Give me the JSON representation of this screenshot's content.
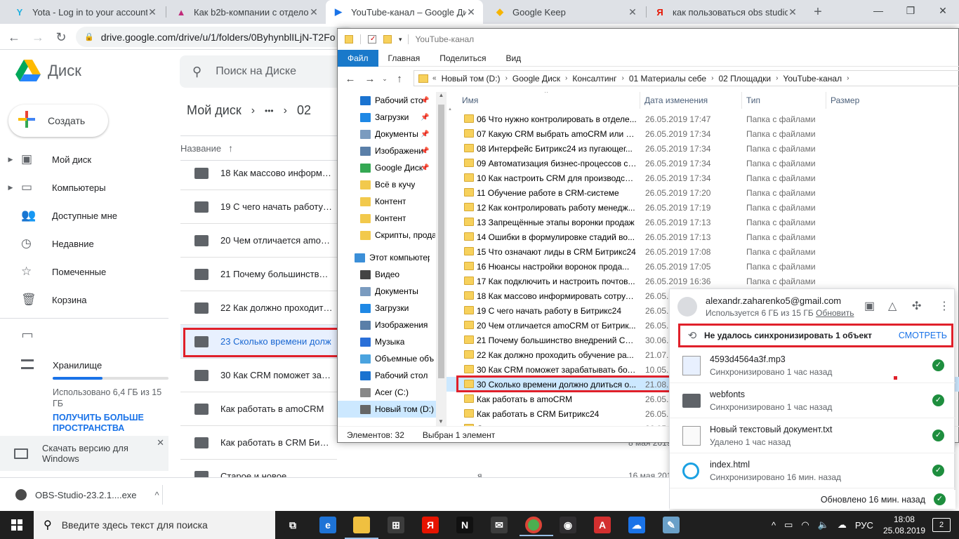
{
  "chrome": {
    "tabs": [
      {
        "title": "Yota - Log in to your account",
        "icon": "yota-icon",
        "color": "#20b0e0"
      },
      {
        "title": "Как b2b-компании с отделом",
        "icon": "triangle-logo-icon",
        "color": "#c12a7a"
      },
      {
        "title": "YouTube-канал – Google Диск",
        "icon": "google-drive-icon",
        "color": "#1a73e8"
      },
      {
        "title": "Google Keep",
        "icon": "google-keep-icon",
        "color": "#f6b400"
      },
      {
        "title": "как пользоваться obs studio",
        "icon": "yandex-icon",
        "color": "#e61400"
      }
    ],
    "active_tab": 2,
    "url": "drive.google.com/drive/u/1/folders/0ByhynblILjN-T2Fo"
  },
  "drive": {
    "app_name": "Диск",
    "search_placeholder": "Поиск на Диске",
    "create_label": "Создать",
    "nav": [
      {
        "label": "Мой диск",
        "icon": "my-drive-icon",
        "expand": true
      },
      {
        "label": "Компьютеры",
        "icon": "computers-icon",
        "expand": true
      },
      {
        "label": "Доступные мне",
        "icon": "shared-with-me-icon",
        "expand": false
      },
      {
        "label": "Недавние",
        "icon": "clock-icon",
        "expand": false
      },
      {
        "label": "Помеченные",
        "icon": "star-icon",
        "expand": false
      },
      {
        "label": "Корзина",
        "icon": "trash-icon",
        "expand": false
      }
    ],
    "storage_label": "Хранилище",
    "storage_used_text": "Использовано 6,4 ГБ из 15 ГБ",
    "storage_fraction": 0.43,
    "storage_more": "ПОЛУЧИТЬ БОЛЬШЕ ПРОСТРАНСТВА",
    "download_promo": "Скачать версию для Windows",
    "breadcrumb": {
      "root": "Мой диск",
      "ellipsis": "•••",
      "next": "02"
    },
    "name_column": "Название",
    "rows": [
      "18 Как массово информиро",
      "19 С чего начать работу в Б",
      "20 Чем отличается amoCRM",
      "21 Почему большинство вне",
      "22 Как должно проходить о",
      "23 Сколько времени долж",
      "30 Как CRM поможет зараб",
      "Как работать в amoCRM",
      "Как работать в CRM Битрикс24",
      "Старое и новое"
    ],
    "selected_row": 5,
    "right_dates": [
      "8 мая 2019 г.",
      "16 мая 2019 г."
    ],
    "right_owner": "я"
  },
  "explorer": {
    "title": "YouTube-канал",
    "ribbon": [
      "Файл",
      "Главная",
      "Поделиться",
      "Вид"
    ],
    "path": [
      "Новый том (D:)",
      "Google Диск",
      "Консалтинг",
      "01 Материалы себе",
      "02 Площадки",
      "YouTube-канал"
    ],
    "nav": [
      {
        "label": "Рабочий сто",
        "pin": true,
        "color": "#1a73d0"
      },
      {
        "label": "Загрузки",
        "pin": true,
        "color": "#1e88e5"
      },
      {
        "label": "Документы",
        "pin": true,
        "color": "#7a9bbf"
      },
      {
        "label": "Изображени",
        "pin": true,
        "color": "#5a7fa8"
      },
      {
        "label": "Google Диск",
        "pin": true,
        "color": "#34a853"
      },
      {
        "label": "Всё в кучу",
        "pin": false,
        "color": "#f2c94c"
      },
      {
        "label": "Контент",
        "pin": false,
        "color": "#f2c94c"
      },
      {
        "label": "Контент",
        "pin": false,
        "color": "#f2c94c"
      },
      {
        "label": "Скрипты, прода",
        "pin": false,
        "color": "#f2c94c"
      },
      {
        "label": "Этот компьютер",
        "pin": false,
        "color": "#3b8fd8"
      },
      {
        "label": "Видео",
        "pin": false,
        "color": "#444"
      },
      {
        "label": "Документы",
        "pin": false,
        "color": "#7a9bbf"
      },
      {
        "label": "Загрузки",
        "pin": false,
        "color": "#1e88e5"
      },
      {
        "label": "Изображения",
        "pin": false,
        "color": "#5a7fa8"
      },
      {
        "label": "Музыка",
        "pin": false,
        "color": "#2a6fd8"
      },
      {
        "label": "Объемные объ",
        "pin": false,
        "color": "#4aa3df"
      },
      {
        "label": "Рабочий стол",
        "pin": false,
        "color": "#1a73d0"
      },
      {
        "label": "Acer (C:)",
        "pin": false,
        "color": "#888"
      },
      {
        "label": "Новый том (D:)",
        "pin": false,
        "color": "#666"
      }
    ],
    "selected_nav": 18,
    "columns": {
      "name": "Имя",
      "date": "Дата изменения",
      "type": "Тип",
      "size": "Размер"
    },
    "files": [
      {
        "name": "06 Что нужно контролировать в отделе...",
        "date": "26.05.2019 17:47",
        "type": "Папка с файлами"
      },
      {
        "name": "07 Какую CRM выбрать amoCRM или Б...",
        "date": "26.05.2019 17:34",
        "type": "Папка с файлами"
      },
      {
        "name": "08 Интерфейс Битрикс24 из пугающег...",
        "date": "26.05.2019 17:34",
        "type": "Папка с файлами"
      },
      {
        "name": "09 Автоматизация бизнес-процессов с ...",
        "date": "26.05.2019 17:34",
        "type": "Папка с файлами"
      },
      {
        "name": "10 Как настроить CRM для производств...",
        "date": "26.05.2019 17:34",
        "type": "Папка с файлами"
      },
      {
        "name": "11 Обучение работе в CRM-системе",
        "date": "26.05.2019 17:20",
        "type": "Папка с файлами"
      },
      {
        "name": "12 Как контролировать работу менедж...",
        "date": "26.05.2019 17:19",
        "type": "Папка с файлами"
      },
      {
        "name": "13 Запрещённые этапы воронки продаж",
        "date": "26.05.2019 17:13",
        "type": "Папка с файлами"
      },
      {
        "name": "14 Ошибки в формулировке стадий во...",
        "date": "26.05.2019 17:13",
        "type": "Папка с файлами"
      },
      {
        "name": "15 Что означают лиды в CRM Битрикс24",
        "date": "26.05.2019 17:08",
        "type": "Папка с файлами"
      },
      {
        "name": "16 Нюансы настройки воронок прода...",
        "date": "26.05.2019 17:05",
        "type": "Папка с файлами"
      },
      {
        "name": "17 Как подключить и настроить почтов...",
        "date": "26.05.2019 16:36",
        "type": "Папка с файлами"
      },
      {
        "name": "18 Как массово информировать сотруд...",
        "date": "26.05.2",
        "type": ""
      },
      {
        "name": "19 С чего начать работу в Битрикс24",
        "date": "26.05.2",
        "type": ""
      },
      {
        "name": "20 Чем отличается amoCRM от Битрик...",
        "date": "26.05.2",
        "type": ""
      },
      {
        "name": "21 Почему большинство внедрений CR...",
        "date": "30.06.2",
        "type": ""
      },
      {
        "name": "22 Как должно проходить обучение ра...",
        "date": "21.07.2",
        "type": ""
      },
      {
        "name": "30 Как CRM поможет зарабатывать бол...",
        "date": "10.05.2",
        "type": ""
      },
      {
        "name": "30 Сколько времени должно длиться о...",
        "date": "21.08.2",
        "type": ""
      },
      {
        "name": "Как работать в amoCRM",
        "date": "26.05.2",
        "type": ""
      },
      {
        "name": "Как работать в CRM Битрикс24",
        "date": "26.05.2",
        "type": ""
      },
      {
        "name": "С...",
        "date": "26.05.2",
        "type": ""
      }
    ],
    "selected_file": 18,
    "status_count": "Элементов: 32",
    "status_selected": "Выбран 1 элемент"
  },
  "sync": {
    "email": "alexandr.zaharenko5@gmail.com",
    "usage": "Используется 6 ГБ из 15 ГБ",
    "upgrade": "Обновить",
    "error": "Не удалось синхронизировать 1 объект",
    "error_action": "СМОТРЕТЬ",
    "items": [
      {
        "name": "4593d4564a3f.mp3",
        "status": "Синхронизировано 1 час назад",
        "icon": "mp3-file-icon"
      },
      {
        "name": "webfonts",
        "status": "Синхронизировано 1 час назад",
        "icon": "folder-icon"
      },
      {
        "name": "Новый текстовый документ.txt",
        "status": "Удалено 1 час назад",
        "icon": "text-file-icon"
      },
      {
        "name": "index.html",
        "status": "Синхронизировано 16 мин. назад",
        "icon": "ie-html-icon"
      }
    ],
    "footer": "Обновлено 16 мин. назад"
  },
  "downloads": {
    "file": "OBS-Studio-23.2.1....exe"
  },
  "taskbar": {
    "search_placeholder": "Введите здесь текст для поиска",
    "apps": [
      {
        "name": "task-view-icon",
        "glyph": "⧉",
        "color": "#1f1f1f"
      },
      {
        "name": "edge-icon",
        "glyph": "e",
        "color": "#1e73d6"
      },
      {
        "name": "file-explorer-icon",
        "glyph": "",
        "color": "#f0c040"
      },
      {
        "name": "store-icon",
        "glyph": "⊞",
        "color": "#3c3c3c"
      },
      {
        "name": "yandex-browser-icon",
        "glyph": "Я",
        "color": "#e61400"
      },
      {
        "name": "netflix-icon",
        "glyph": "N",
        "color": "#111"
      },
      {
        "name": "mail-icon",
        "glyph": "✉",
        "color": "#3c3c3c"
      },
      {
        "name": "chrome-icon",
        "glyph": "",
        "color": "#4caf50"
      },
      {
        "name": "obs-icon",
        "glyph": "◉",
        "color": "#302e31"
      },
      {
        "name": "acrobat-icon",
        "glyph": "A",
        "color": "#d32f2f"
      },
      {
        "name": "backup-sync-icon",
        "glyph": "☁",
        "color": "#1a73e8"
      },
      {
        "name": "notepad-icon",
        "glyph": "✎",
        "color": "#6aa0c8"
      }
    ],
    "lang": "РУС",
    "time": "18:08",
    "date": "25.08.2019",
    "notifications": "2"
  }
}
